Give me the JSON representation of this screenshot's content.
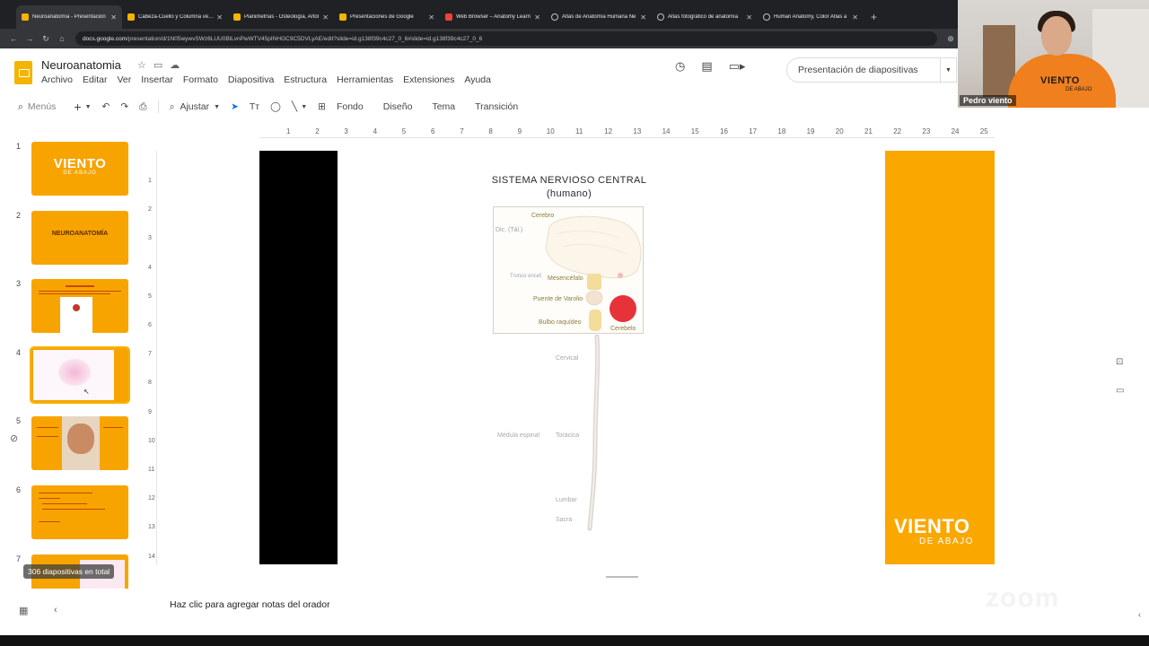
{
  "browser": {
    "tabs": [
      {
        "title": "Neuroanatomía - Presentación",
        "fav": "slides",
        "active": true
      },
      {
        "title": "Cabeza-Cuello y Columna verte",
        "fav": "slides"
      },
      {
        "title": "Planimetrías - Osteología, Artol",
        "fav": "slides"
      },
      {
        "title": "Presentaciones de Google",
        "fav": "slides"
      },
      {
        "title": "Web Browser – Anatomy Learn",
        "fav": "red"
      },
      {
        "title": "Atlas de Anatomía Humana Ne",
        "fav": "globe"
      },
      {
        "title": "Atlas fotográfico de anatomía",
        "fav": "globe"
      },
      {
        "title": "Human Anatomy, Color Atlas a",
        "fav": "globe"
      }
    ],
    "close_glyph": "✕",
    "new_tab_glyph": "+",
    "url_host": "docs.google.com",
    "url_path": "/presentation/d/1N05wywvSWz6LUU0BlLvnPwWTV45pINHGC9C5DVLyAE/edit?slide=id.g138f39c4c27_0_6#slide=id.g138f39c4c27_0_6"
  },
  "app": {
    "title": "Neuroanatomia",
    "menus": [
      "Archivo",
      "Editar",
      "Ver",
      "Insertar",
      "Formato",
      "Diapositiva",
      "Estructura",
      "Herramientas",
      "Extensiones",
      "Ayuda"
    ],
    "present_label": "Presentación de diapositivas"
  },
  "toolbar": {
    "search_placeholder": "Menús",
    "zoom_label": "Ajustar",
    "fondo": "Fondo",
    "diseno": "Diseño",
    "tema": "Tema",
    "transicion": "Transición"
  },
  "webcam": {
    "name": "Pedro viento",
    "shirt_line1": "VIENTO",
    "shirt_line2": "DE ABAJO"
  },
  "filmstrip": {
    "numbers": [
      "1",
      "2",
      "3",
      "4",
      "5",
      "6",
      "7"
    ],
    "slide1_big": "VIENTO",
    "slide1_small": "DE ABAJO",
    "slide2_title": "NEUROANATOMÍA",
    "total_label": "306 diapositivas en total"
  },
  "rulers": {
    "h": [
      "1",
      "2",
      "3",
      "4",
      "5",
      "6",
      "7",
      "8",
      "9",
      "10",
      "11",
      "12",
      "13",
      "14",
      "15",
      "16",
      "17",
      "18",
      "19",
      "20",
      "21",
      "22",
      "23",
      "24",
      "25"
    ],
    "v": [
      "1",
      "2",
      "3",
      "4",
      "5",
      "6",
      "7",
      "8",
      "9",
      "10",
      "11",
      "12",
      "13",
      "14"
    ]
  },
  "slide": {
    "title_line1": "SISTEMA NERVIOSO CENTRAL",
    "title_line2": "(humano)",
    "labels": {
      "cerebro": "Cerebro",
      "diencefalo": "Dic. (Tál.)",
      "mesencefalo": "Mesencéfalo",
      "puente": "Puente de Varolio",
      "bulbo": "Bulbo raquídeo",
      "cerebelo": "Cerebelo",
      "tronco": "Tronco encef.",
      "cervical": "Cervical",
      "medula": "Médula espinal",
      "toracica": "Torácica",
      "lumbar": "Lumbar",
      "sacra": "Sacra"
    },
    "brand_big": "VIENTO",
    "brand_small": "DE ABAJO"
  },
  "notes_placeholder": "Haz clic para agregar notas del orador",
  "watermark": "zoom",
  "colors": {
    "accent_orange": "#faa700",
    "slides_yellow": "#f4b400"
  }
}
